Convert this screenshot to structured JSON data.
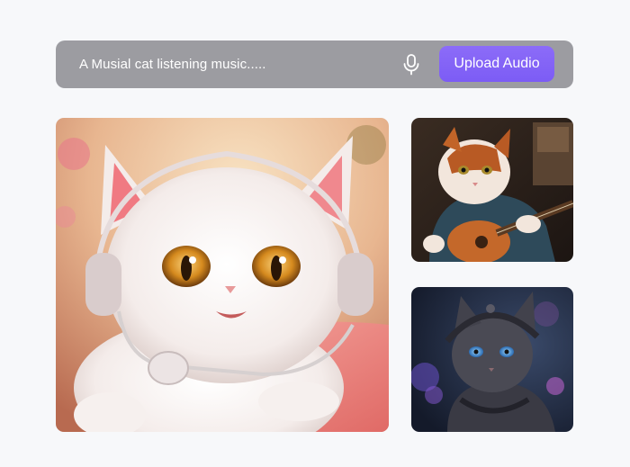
{
  "search": {
    "prompt": "A Musial cat listening music.....",
    "mic_icon": "microphone-icon",
    "upload_label": "Upload Audio"
  },
  "gallery": [
    {
      "name": "white-kitten-headphones",
      "subject": "image"
    },
    {
      "name": "calico-cat-guitar",
      "subject": "image"
    },
    {
      "name": "dark-cat-headphones",
      "subject": "image"
    }
  ],
  "colors": {
    "bar": "#9c9ca1",
    "accent": "#7c5cf5",
    "background": "#f7f8fa"
  }
}
